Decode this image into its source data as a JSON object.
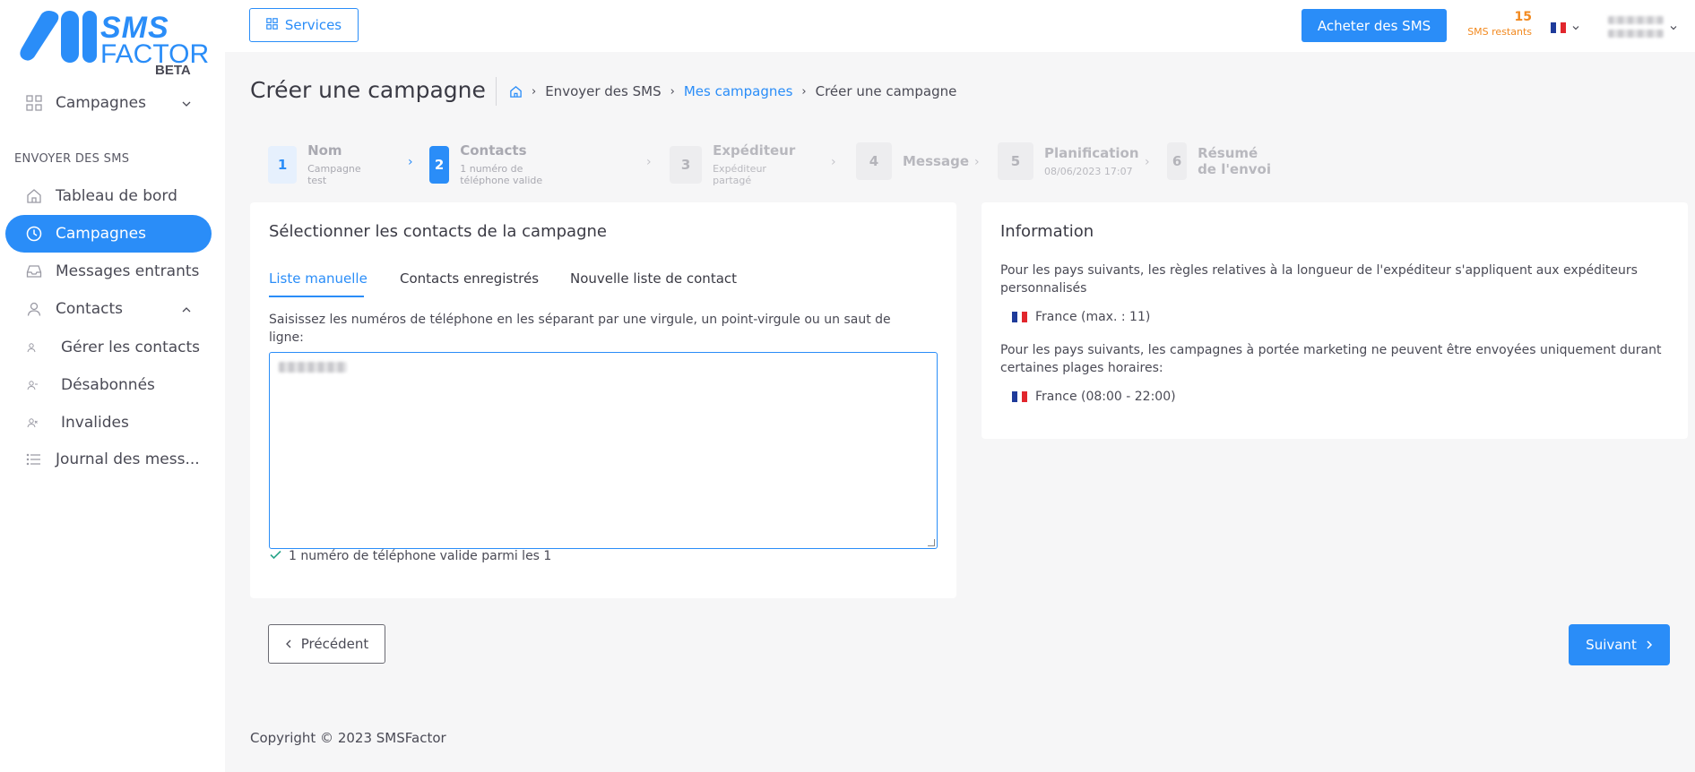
{
  "brand": {
    "line1": "SMS",
    "line2": "FACTOR",
    "badge": "BETA"
  },
  "sidebar": {
    "top_item": {
      "label": "Campagnes",
      "icon": "grid-icon"
    },
    "section_label": "ENVOYER DES SMS",
    "items": [
      {
        "label": "Tableau de bord",
        "icon": "home-icon"
      },
      {
        "label": "Campagnes",
        "icon": "clock-icon"
      },
      {
        "label": "Messages entrants",
        "icon": "inbox-icon"
      },
      {
        "label": "Contacts",
        "icon": "user-icon"
      }
    ],
    "sub_items": [
      {
        "label": "Gérer les contacts",
        "icon": "user-small-icon"
      },
      {
        "label": "Désabonnés",
        "icon": "user-minus-icon"
      },
      {
        "label": "Invalides",
        "icon": "user-x-icon"
      }
    ],
    "last_item": {
      "label": "Journal des mess...",
      "icon": "list-icon"
    }
  },
  "topbar": {
    "services_label": "Services",
    "buy_label": "Acheter des SMS",
    "sms_count": "15",
    "sms_count_label": "SMS restants"
  },
  "page": {
    "title": "Créer une campagne",
    "breadcrumb": [
      "Envoyer des SMS",
      "Mes campagnes",
      "Créer une campagne"
    ]
  },
  "steps": [
    {
      "num": "1",
      "title": "Nom",
      "sub": "Campagne test"
    },
    {
      "num": "2",
      "title": "Contacts",
      "sub": "1 numéro de téléphone valide"
    },
    {
      "num": "3",
      "title": "Expéditeur",
      "sub": "Expéditeur partagé"
    },
    {
      "num": "4",
      "title": "Message",
      "sub": ""
    },
    {
      "num": "5",
      "title": "Planification",
      "sub": "08/06/2023 17:07"
    },
    {
      "num": "6",
      "title": "Résumé de l'envoi",
      "sub": ""
    }
  ],
  "contacts_card": {
    "title": "Sélectionner les contacts de la campagne",
    "tabs": [
      "Liste manuelle",
      "Contacts enregistrés",
      "Nouvelle liste de contact"
    ],
    "help": "Saisissez les numéros de téléphone en les séparant par une virgule, un point-virgule ou un saut de ligne:",
    "valid_text": "1 numéro de téléphone valide parmi les 1"
  },
  "info_card": {
    "title": "Information",
    "para1": "Pour les pays suivants, les règles relatives à la longueur de l'expéditeur s'appliquent aux expéditeurs personnalisés",
    "country1": "France (max. : 11)",
    "para2": "Pour les pays suivants, les campagnes à portée marketing ne peuvent être envoyées uniquement durant certaines plages horaires:",
    "country2": "France (08:00 - 22:00)"
  },
  "buttons": {
    "prev": "Précédent",
    "next": "Suivant"
  },
  "footer": "Copyright © 2023 SMSFactor",
  "colors": {
    "accent": "#2a8df8",
    "warning": "#f2891f"
  }
}
